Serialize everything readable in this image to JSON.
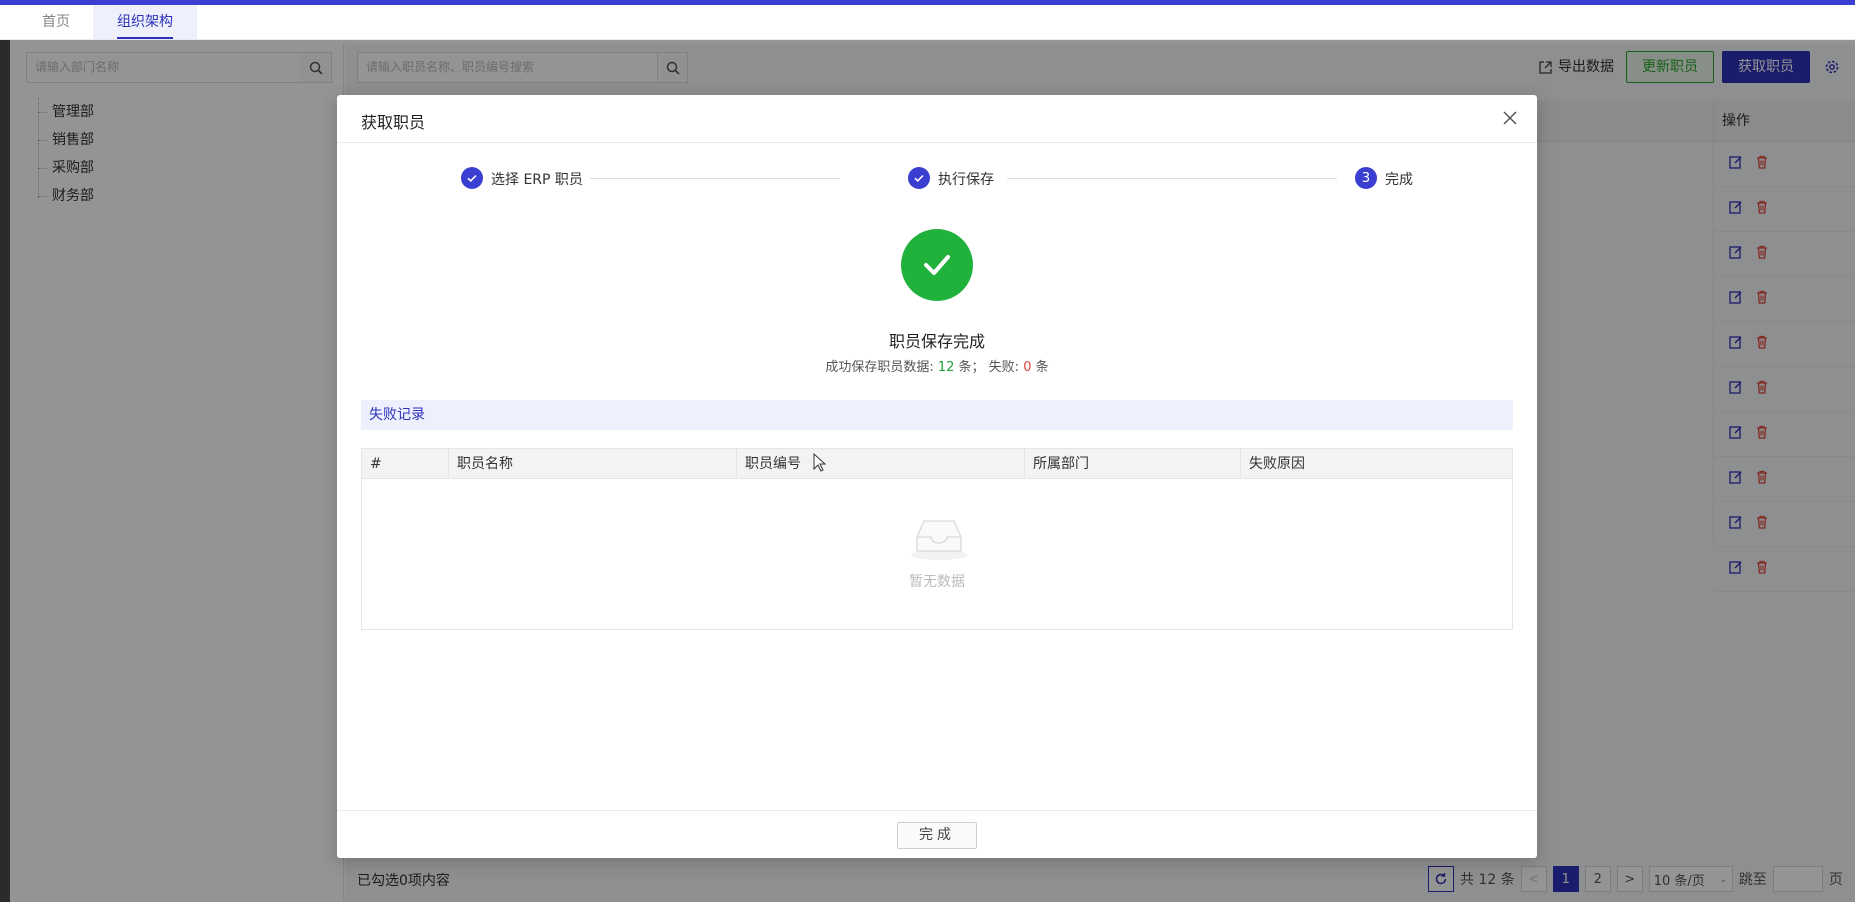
{
  "tabs": [
    {
      "label": "首页",
      "active": false
    },
    {
      "label": "组织架构",
      "active": true
    }
  ],
  "dept_panel": {
    "search_placeholder": "请输入部门名称",
    "departments": [
      "管理部",
      "销售部",
      "采购部",
      "财务部"
    ]
  },
  "toolbar": {
    "search_placeholder": "请输入职员名称、职员编号搜索",
    "export_label": "导出数据",
    "update_label": "更新职员",
    "fetch_label": "获取职员"
  },
  "table": {
    "op_header": "操作",
    "row_count": 10
  },
  "footer": {
    "selected_text": "已勾选0项内容",
    "total_text": "共 12 条",
    "pages": [
      "1",
      "2"
    ],
    "current_page": "1",
    "page_size": "10 条/页",
    "jump_label": "跳至",
    "page_unit": "页"
  },
  "modal": {
    "title": "获取职员",
    "steps": [
      {
        "label": "选择 ERP 职员",
        "status": "done"
      },
      {
        "label": "执行保存",
        "status": "done"
      },
      {
        "label": "完成",
        "status": "current",
        "number": "3"
      }
    ],
    "result_title": "职员保存完成",
    "result_prefix": "成功保存职员数据: ",
    "success_count": "12",
    "result_mid": " 条； 失败: ",
    "fail_count": "0",
    "result_suffix": " 条",
    "fail_section_title": "失败记录",
    "fail_columns": [
      "#",
      "职员名称",
      "职员编号",
      "所属部门",
      "失败原因"
    ],
    "empty_text": "暂无数据",
    "done_button": "完成"
  },
  "colors": {
    "primary": "#3a3fd1",
    "success": "#21b23c",
    "danger": "#e0443a"
  }
}
